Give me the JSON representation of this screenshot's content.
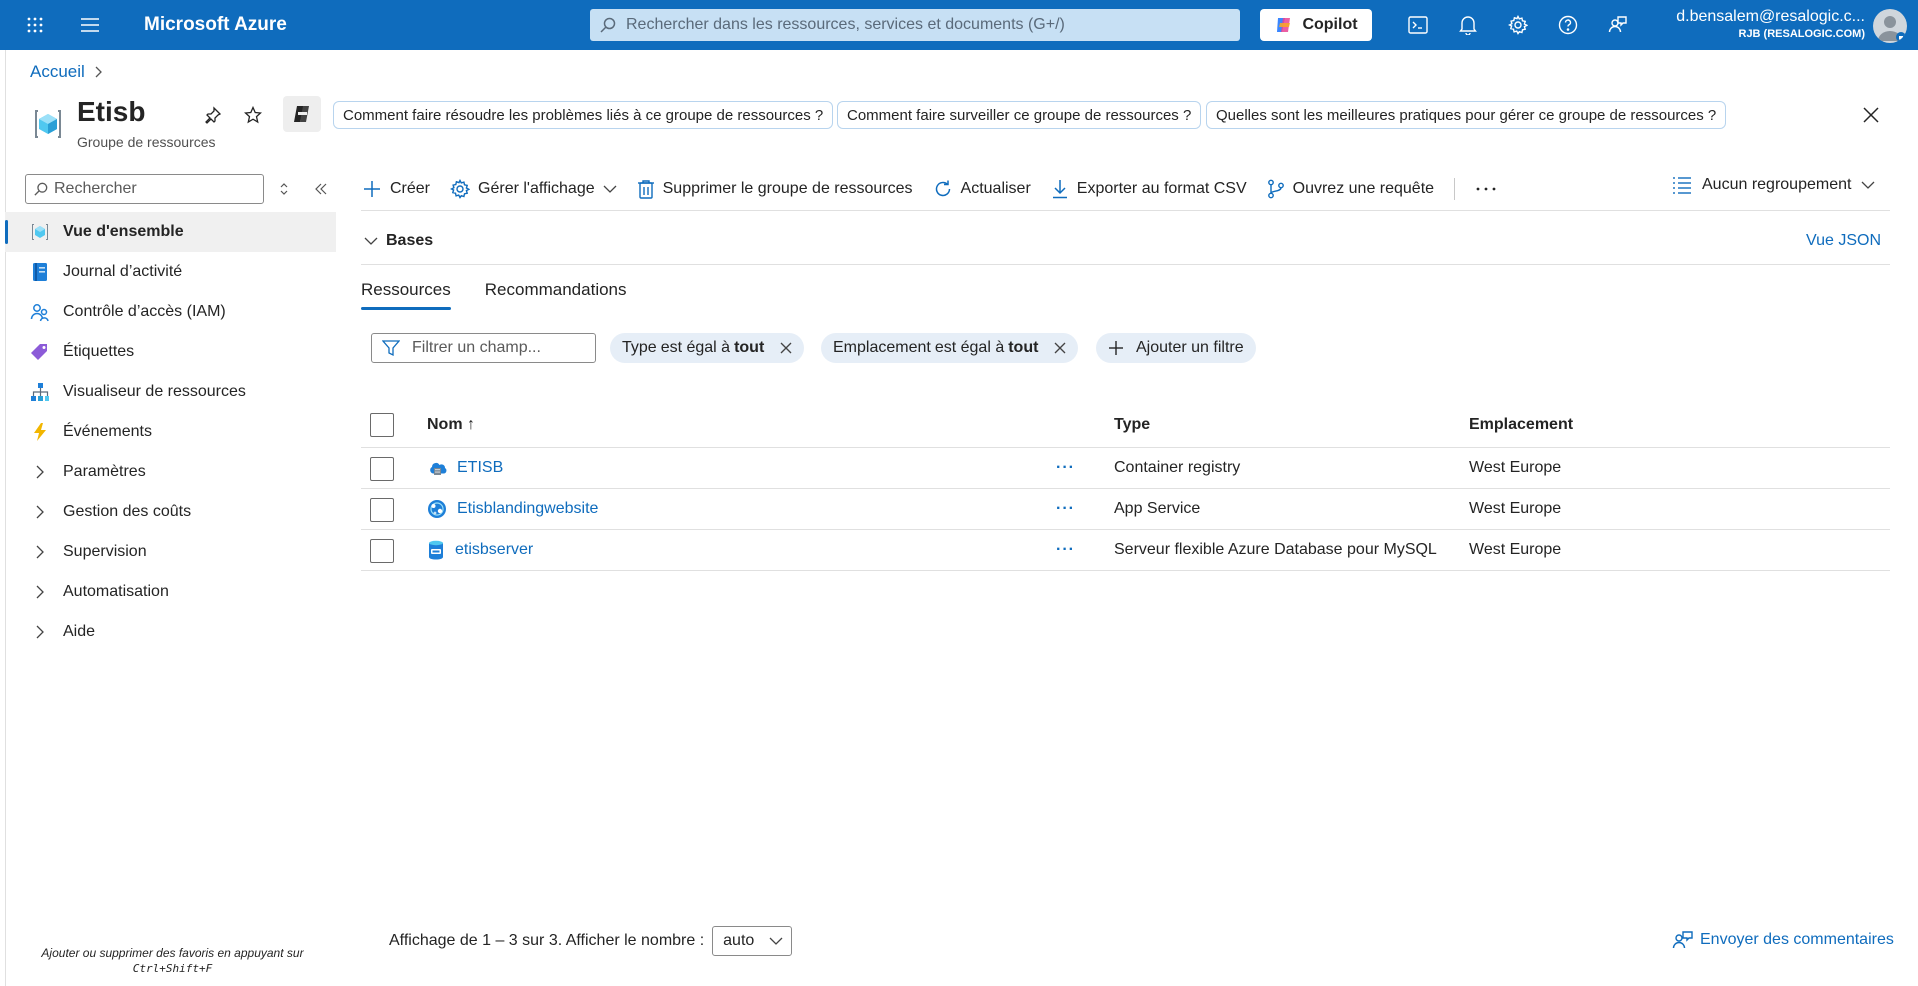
{
  "topbar": {
    "brand": "Microsoft Azure",
    "search_placeholder": "Rechercher dans les ressources, services et documents (G+/)",
    "copilot_label": "Copilot",
    "user_email": "d.bensalem@resalogic.c...",
    "user_tenant": "RJB (RESALOGIC.COM)",
    "brand_color": "#0f6cbd"
  },
  "breadcrumb": {
    "home": "Accueil"
  },
  "header": {
    "title": "Etisb",
    "subtitle": "Groupe de ressources",
    "suggestions": [
      "Comment faire résoudre les problèmes liés à ce groupe de ressources ?",
      "Comment faire surveiller ce groupe de ressources ?",
      "Quelles sont les meilleures pratiques pour gérer ce groupe de ressources ?"
    ]
  },
  "sidebar": {
    "search_placeholder": "Rechercher",
    "items": [
      {
        "label": "Vue d'ensemble",
        "icon": "overview-icon",
        "active": true
      },
      {
        "label": "Journal d’activité",
        "icon": "activity-log-icon"
      },
      {
        "label": "Contrôle d’accès (IAM)",
        "icon": "iam-icon"
      },
      {
        "label": "Étiquettes",
        "icon": "tag-icon"
      },
      {
        "label": "Visualiseur de ressources",
        "icon": "resource-visualizer-icon"
      },
      {
        "label": "Événements",
        "icon": "events-icon"
      },
      {
        "label": "Paramètres",
        "expandable": true
      },
      {
        "label": "Gestion des coûts",
        "expandable": true
      },
      {
        "label": "Supervision",
        "expandable": true
      },
      {
        "label": "Automatisation",
        "expandable": true
      },
      {
        "label": "Aide",
        "expandable": true
      }
    ],
    "favorites_hint": "Ajouter ou supprimer des favoris en appuyant sur",
    "favorites_shortcut": "Ctrl+Shift+F"
  },
  "toolbar": {
    "create": "Créer",
    "manage_view": "Gérer l'affichage",
    "delete": "Supprimer le groupe de ressources",
    "refresh": "Actualiser",
    "export": "Exporter au format CSV",
    "query": "Ouvrez une requête",
    "grouping": "Aucun regroupement"
  },
  "essentials": {
    "label": "Bases",
    "json_view": "Vue JSON"
  },
  "tabs": [
    "Ressources",
    "Recommandations"
  ],
  "filters": {
    "placeholder": "Filtrer un champ...",
    "type_pill": {
      "field": "Type",
      "op": "est égal à",
      "value": "tout"
    },
    "location_pill": {
      "field": "Emplacement",
      "op": "est égal à",
      "value": "tout"
    },
    "add_filter": "Ajouter un filtre"
  },
  "table": {
    "columns": {
      "name": "Nom ↑",
      "type": "Type",
      "location": "Emplacement"
    },
    "rows": [
      {
        "name": "ETISB",
        "type": "Container registry",
        "location": "West Europe",
        "icon": "container-registry-icon"
      },
      {
        "name": "Etisblandingwebsite",
        "type": "App Service",
        "location": "West Europe",
        "icon": "app-service-icon"
      },
      {
        "name": "etisbserver",
        "type": "Serveur flexible Azure Database pour MySQL",
        "location": "West Europe",
        "icon": "mysql-icon"
      }
    ],
    "more": "···"
  },
  "footer": {
    "paging": "Affichage de 1 – 3 sur 3. Afficher le nombre :",
    "page_size": "auto",
    "feedback": "Envoyer des commentaires"
  }
}
